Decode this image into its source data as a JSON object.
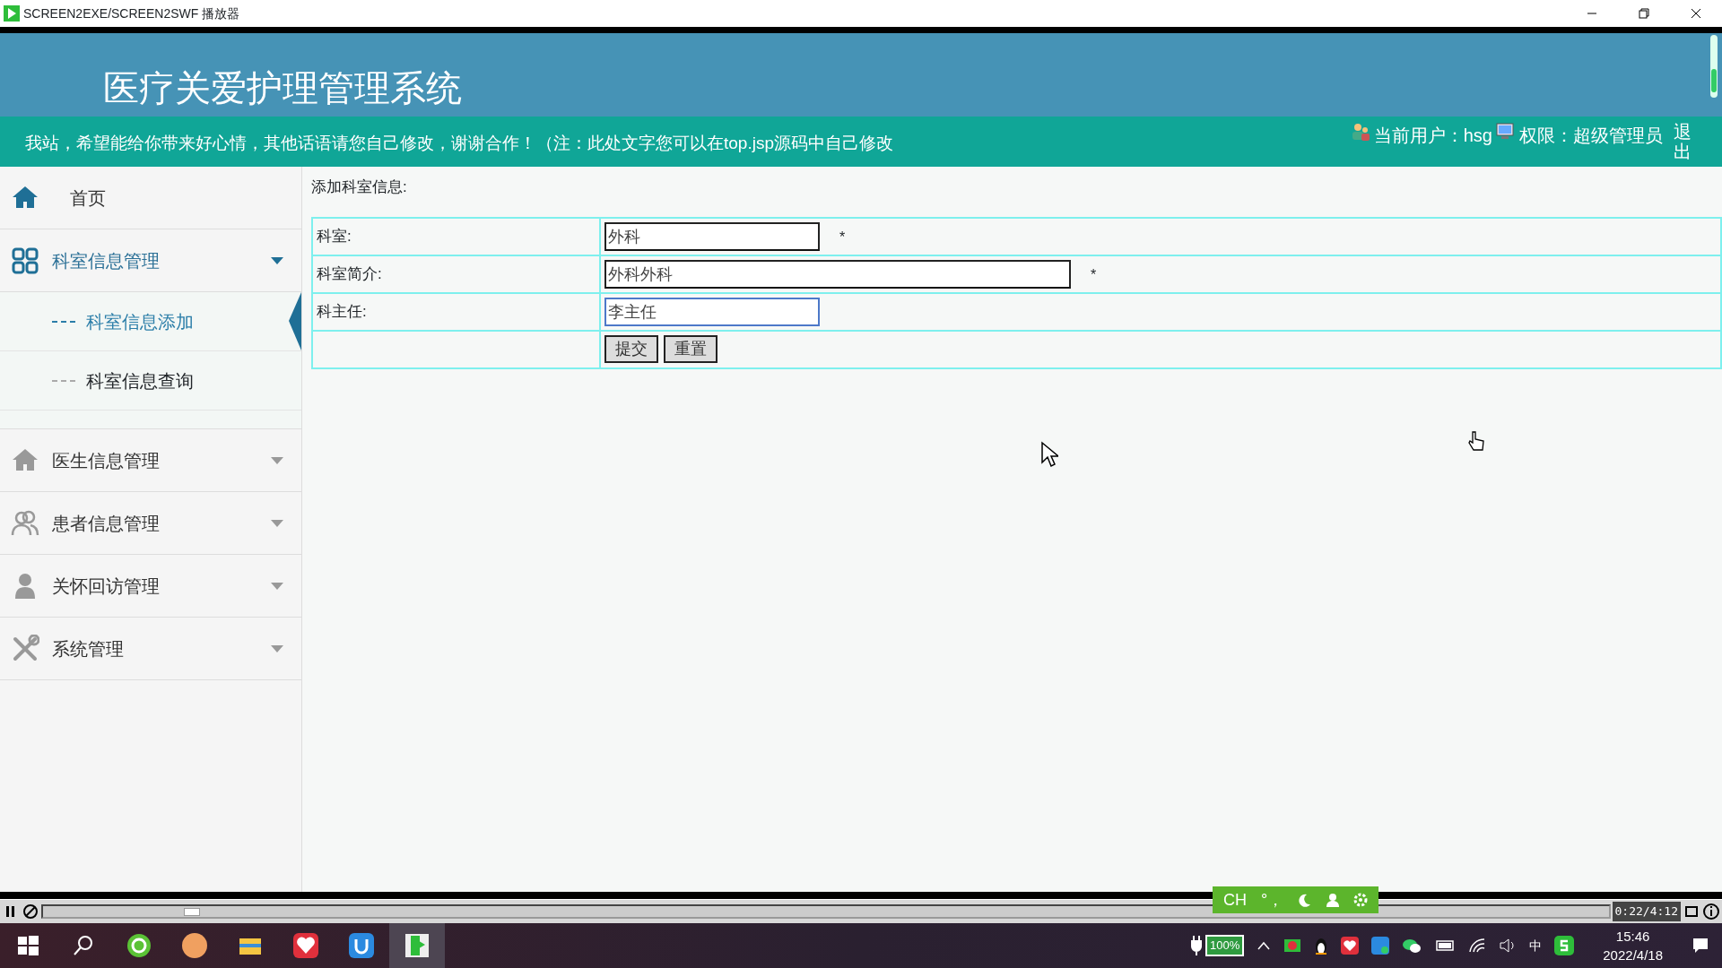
{
  "window": {
    "title": "SCREEN2EXE/SCREEN2SWF 播放器"
  },
  "app": {
    "title": "医疗关爱护理管理系统",
    "notice": "我站，希望能给你带来好心情，其他话语请您自己修改，谢谢合作！（注：此处文字您可以在top.jsp源码中自己修改",
    "current_user": "当前用户：hsg",
    "role": "权限：超级管理员",
    "logout": "退出"
  },
  "sidebar": {
    "items": [
      {
        "label": "首页",
        "kind": "link"
      },
      {
        "label": "科室信息管理",
        "kind": "group",
        "expanded": true,
        "children": [
          {
            "label": "科室信息添加",
            "selected": true
          },
          {
            "label": "科室信息查询",
            "selected": false
          }
        ]
      },
      {
        "label": "医生信息管理",
        "kind": "group",
        "expanded": false
      },
      {
        "label": "患者信息管理",
        "kind": "group",
        "expanded": false
      },
      {
        "label": "关怀回访管理",
        "kind": "group",
        "expanded": false
      },
      {
        "label": "系统管理",
        "kind": "group",
        "expanded": false
      }
    ]
  },
  "form": {
    "heading": "添加科室信息:",
    "rows": [
      {
        "label": "科室:",
        "value": "外科",
        "required_mark": "*",
        "focused": false
      },
      {
        "label": "科室简介:",
        "value": "外科外科",
        "required_mark": "*",
        "focused": false
      },
      {
        "label": "科主任:",
        "value": "李主任",
        "focused": true
      }
    ],
    "buttons": [
      "提交",
      "重置"
    ]
  },
  "player": {
    "progress": {
      "level": 0.09
    },
    "time": "0:22/4:12"
  },
  "ime_bar": {
    "mode": "CH",
    "punct": "°，"
  },
  "taskbar": {
    "battery": "100%",
    "ime": "中",
    "time": "15:46",
    "date": "2022/4/18"
  }
}
